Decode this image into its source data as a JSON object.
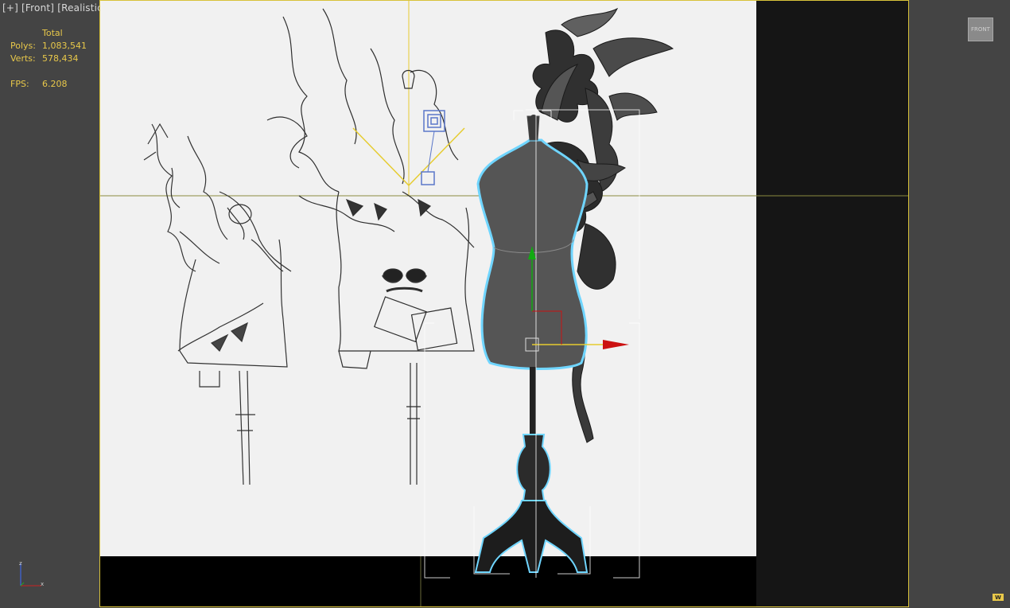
{
  "viewport": {
    "label_plus": "[+]",
    "label_view": "[Front]",
    "label_shading": "[Realistic]"
  },
  "stats": {
    "total_label": "Total",
    "polys_label": "Polys:",
    "polys_value": "1,083,541",
    "verts_label": "Verts:",
    "verts_value": "578,434",
    "fps_label": "FPS:",
    "fps_value": "6.208"
  },
  "viewcube": {
    "label": "FRONT"
  },
  "axis": {
    "z": "z",
    "x": "x"
  },
  "badge": {
    "label": "W"
  },
  "colors": {
    "viewport_border": "#d8c23a",
    "stats_text": "#e8c84a",
    "selection_highlight": "#5ecbff",
    "gizmo_x": "#cc1111",
    "gizmo_y": "#11aa11"
  },
  "icons": [
    "viewcube-icon",
    "axis-tripod-icon",
    "light-target-icon",
    "move-gizmo-icon"
  ]
}
